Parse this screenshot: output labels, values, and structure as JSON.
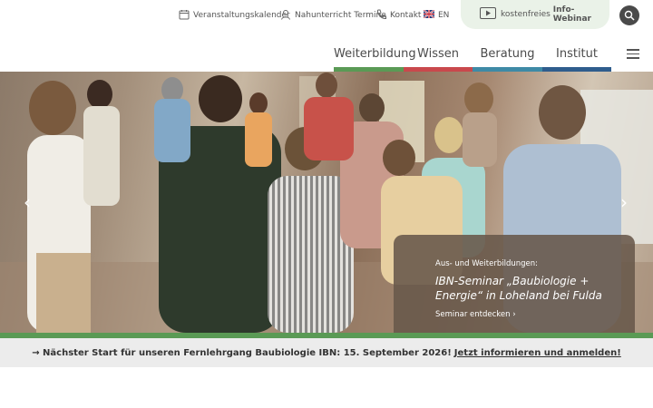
{
  "topbar": {
    "calendar_label": "Veranstaltungskalender",
    "distance_label": "Nahunterricht Termine",
    "contact_label": "Kontakt",
    "lang_label": "EN",
    "webinar_prefix": "kostenfreies",
    "webinar_bold": "Info-Webinar"
  },
  "nav": {
    "items": [
      {
        "label": "Weiterbildung",
        "color": "#5a9a55"
      },
      {
        "label": "Wissen",
        "color": "#c9484c"
      },
      {
        "label": "Beratung",
        "color": "#3e8aa6"
      },
      {
        "label": "Institut",
        "color": "#2f5d8d"
      }
    ]
  },
  "hero": {
    "kicker": "Aus- und Weiterbildungen:",
    "title": "IBN-Seminar „Baubiologie + Energie“ in Loheland bei Fulda",
    "link": "Seminar entdecken"
  },
  "banner": {
    "text": "→ Nächster Start für unseren Fernlehrgang Baubiologie IBN: 15. September 2026!",
    "link": "Jetzt informieren und anmelden!"
  }
}
